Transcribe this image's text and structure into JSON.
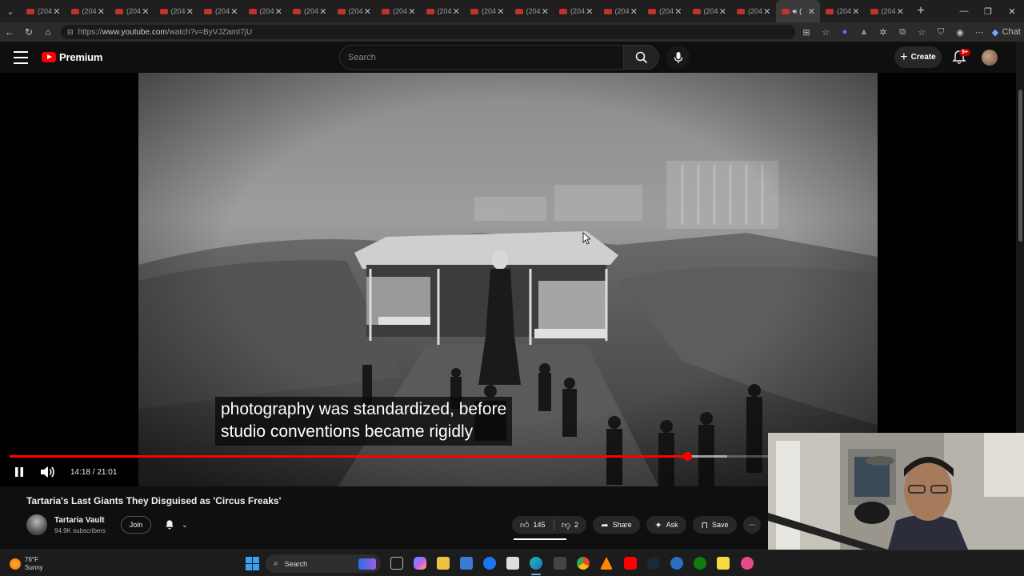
{
  "browser": {
    "tabs": [
      {
        "label": "(204"
      },
      {
        "label": "(204"
      },
      {
        "label": "(204"
      },
      {
        "label": "(204"
      },
      {
        "label": "(204"
      },
      {
        "label": "(204"
      },
      {
        "label": "(204"
      },
      {
        "label": "(204"
      },
      {
        "label": "(204"
      },
      {
        "label": "(204"
      },
      {
        "label": "(204"
      },
      {
        "label": "(204"
      },
      {
        "label": "(204"
      },
      {
        "label": "(204"
      },
      {
        "label": "(204"
      },
      {
        "label": "(204"
      },
      {
        "label": "(204"
      },
      {
        "label": "(",
        "active": true
      },
      {
        "label": "(204"
      },
      {
        "label": "(204"
      }
    ],
    "url_prefix": "https://",
    "url_host": "www.youtube.com",
    "url_path": "/watch?v=ByVJZamI7jU",
    "copilot_label": "Chat"
  },
  "masthead": {
    "logo_text": "Premium",
    "search_placeholder": "Search",
    "create_label": "Create",
    "notification_badge": "9+"
  },
  "player": {
    "subtitle_lines": [
      "photography was standardized, before",
      "studio conventions became rigidly"
    ],
    "time_current": "14:18",
    "time_total": "21:01",
    "time_display": "14:18 / 21:01",
    "progress_fraction": 0.68,
    "buffer_fraction": 0.72
  },
  "video": {
    "title": "Tartaria's Last Giants They Disguised as 'Circus Freaks'",
    "channel_name": "Tartaria Vault",
    "channel_subs": "94.9K subscribers",
    "join_label": "Join",
    "likes": "145",
    "dislikes": "2",
    "share_label": "Share",
    "ask_label": "Ask",
    "save_label": "Save"
  },
  "taskbar": {
    "weather_temp": "76°F",
    "weather_cond": "Sunny",
    "search_label": "Search"
  },
  "colors": {
    "yt_red": "#ff0000",
    "background": "#0f0f0f",
    "button_bg": "#272727",
    "start_blue": "#3aa0f0"
  }
}
